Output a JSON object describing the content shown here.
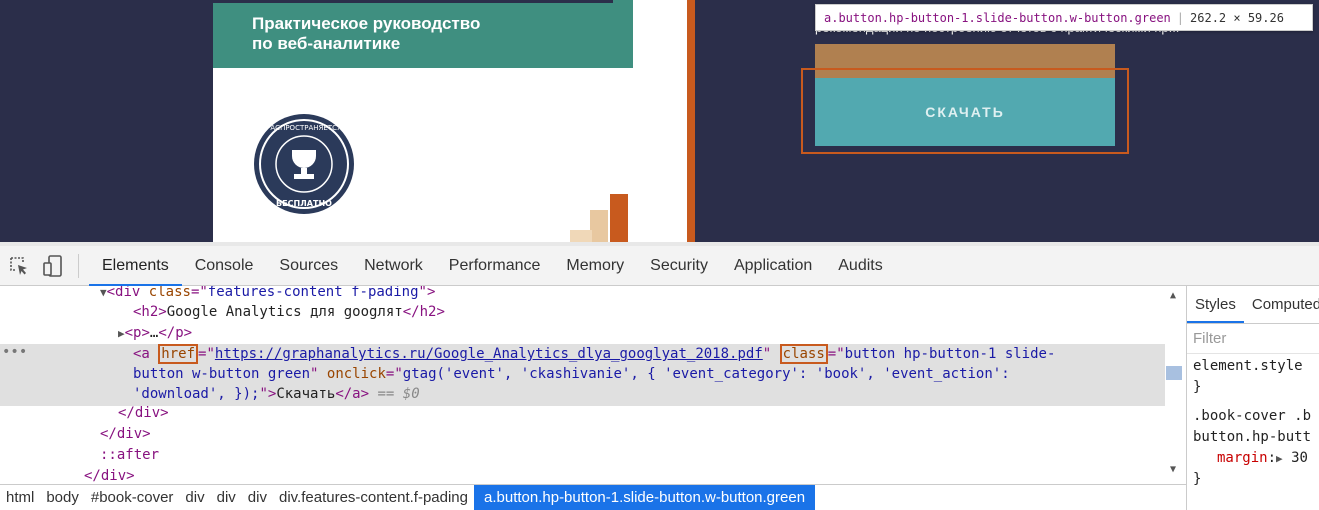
{
  "page": {
    "book_title": "Практическое руководство\nпо веб-аналитике",
    "seal_text_top": "РАСПРОСТРАНЯЕТСЯ",
    "seal_text_bottom": "БЕСПЛАТНО",
    "top_clipped_text": "рекомендации по построению отчетов с практическими пр...",
    "download_label": "СКАЧАТЬ",
    "tooltip_selector": "a.button.hp-button-1.slide-button.w-button.green",
    "tooltip_dims": "262.2 × 59.26"
  },
  "devtools": {
    "tabs": [
      "Elements",
      "Console",
      "Sources",
      "Network",
      "Performance",
      "Memory",
      "Security",
      "Application",
      "Audits"
    ],
    "active_tab": "Elements",
    "dom": {
      "line1_tag_open": "<div ",
      "line1_attr": "class",
      "line1_eq": "=\"",
      "line1_val": "features-content f-pading",
      "line1_close": "\">",
      "h2_open": "<h2>",
      "h2_text": "Google Analytics для googлят",
      "h2_close": "</h2>",
      "p_collapsed_open": "<p>",
      "p_collapsed_ellipsis": "…",
      "p_collapsed_close": "</p>",
      "a_open": "<a ",
      "href_attr": "href",
      "href_val": "https://graphanalytics.ru/Google_Analytics_dlya_googlyat_2018.pdf",
      "class_attr": "class",
      "class_val_1": "button hp-button-1 slide-",
      "class_val_2": "button w-button green",
      "onclick_attr": "onclick",
      "onclick_val_1": "gtag('event', 'ckashivanie', { 'event_category': 'book', 'event_action':",
      "onclick_val_2": "'download', });",
      "a_text": "Скачать",
      "a_close": "</a>",
      "dollar_ref": "== $0",
      "div_close": "</div>",
      "after": "::after",
      "dots": "•••"
    },
    "styles": {
      "tabs": [
        "Styles",
        "Computed"
      ],
      "filter_placeholder": "Filter",
      "element_style": "element.style",
      "brace_close": "}",
      "rule_selector_1": ".book-cover .b",
      "rule_selector_2": "button.hp-butt",
      "prop_name": "margin",
      "prop_value": "30"
    },
    "breadcrumbs": [
      "html",
      "body",
      "#book-cover",
      "div",
      "div",
      "div",
      "div.features-content.f-pading",
      "a.button.hp-button-1.slide-button.w-button.green"
    ]
  },
  "colors": {
    "page_bg": "#2b2e4a",
    "banner_green": "#3f8f80",
    "accent_orange": "#c85a1e",
    "button_teal": "#52a9b0",
    "devtools_blue": "#1a73e8"
  }
}
